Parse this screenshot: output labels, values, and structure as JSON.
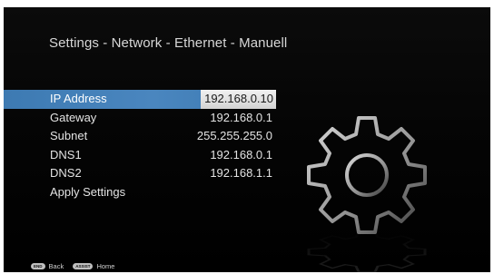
{
  "screen": {
    "title": "Settings - Network - Ethernet - Manuell"
  },
  "menu": {
    "items": [
      {
        "label": "IP Address",
        "value": "192.168.0.10",
        "selected": true
      },
      {
        "label": "Gateway",
        "value": "192.168.0.1"
      },
      {
        "label": "Subnet",
        "value": "255.255.255.0"
      },
      {
        "label": "DNS1",
        "value": "192.168.0.1"
      },
      {
        "label": "DNS2",
        "value": "192.168.1.1"
      },
      {
        "label": "Apply Settings",
        "value": ""
      }
    ]
  },
  "footer": {
    "back_key": "END",
    "back_label": "Back",
    "home_key": "ASSIST",
    "home_label": "Home"
  },
  "colors": {
    "background": "#000000",
    "selection_accent": "#4a86bf",
    "text": "#e3e3e3"
  },
  "icons": {
    "decor": "gear-icon"
  }
}
